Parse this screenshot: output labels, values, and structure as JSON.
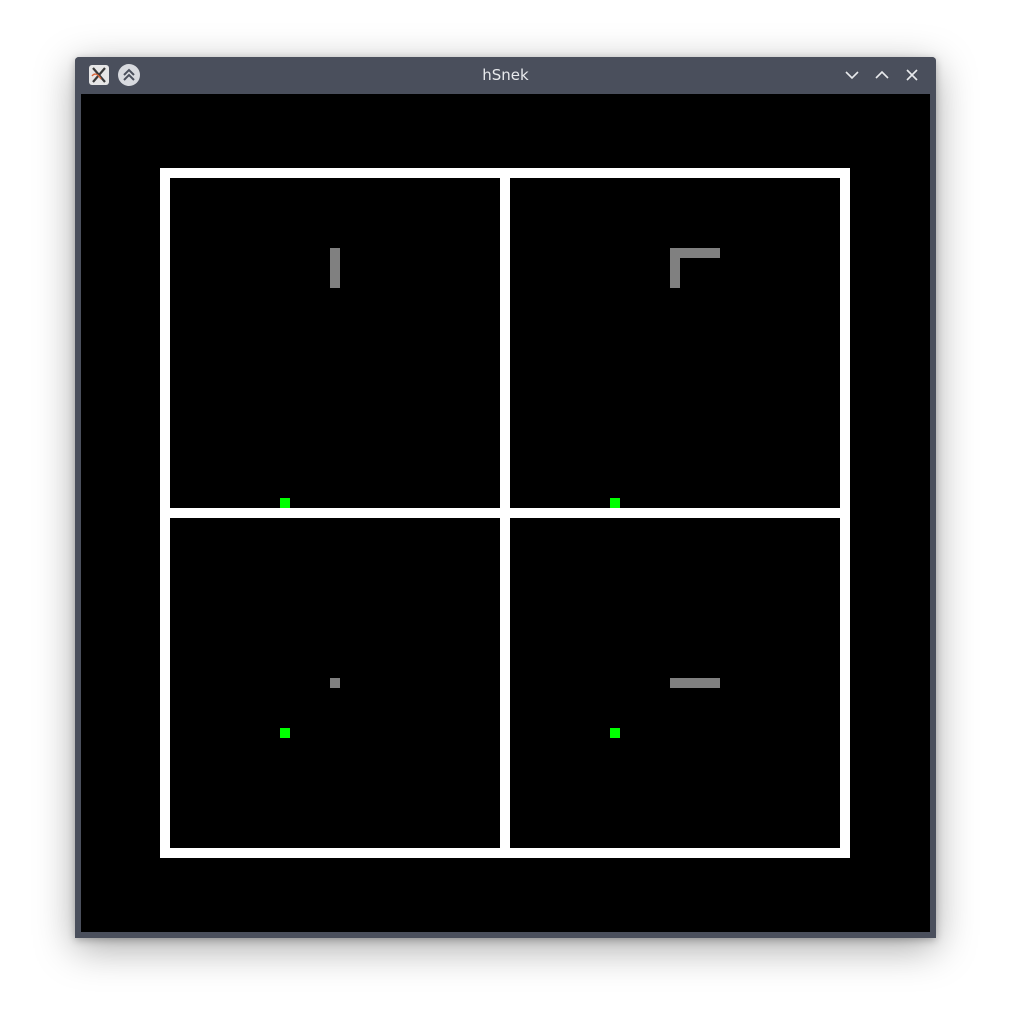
{
  "window": {
    "title": "hSnek",
    "app_icon": "x-app-icon",
    "keep_above_icon": "double-chevron-up-icon",
    "controls": [
      "minimize-chevron-down-icon",
      "maximize-chevron-up-icon",
      "close-x-icon"
    ]
  },
  "game": {
    "board_color": "#000000",
    "border_color": "#ffffff",
    "piece_color": "#808080",
    "food_color": "#00ff00",
    "grid_cells_per_panel": 33,
    "panels": [
      {
        "piece_cells": [
          [
            16,
            7
          ],
          [
            16,
            8
          ],
          [
            16,
            9
          ],
          [
            16,
            10
          ]
        ],
        "food_cell": [
          11,
          32
        ]
      },
      {
        "piece_cells": [
          [
            16,
            7
          ],
          [
            17,
            7
          ],
          [
            18,
            7
          ],
          [
            19,
            7
          ],
          [
            20,
            7
          ],
          [
            16,
            8
          ],
          [
            16,
            9
          ],
          [
            16,
            10
          ]
        ],
        "food_cell": [
          10,
          32
        ]
      },
      {
        "piece_cells": [
          [
            16,
            16
          ]
        ],
        "food_cell": [
          11,
          21
        ]
      },
      {
        "piece_cells": [
          [
            16,
            16
          ],
          [
            17,
            16
          ],
          [
            18,
            16
          ],
          [
            19,
            16
          ],
          [
            20,
            16
          ]
        ],
        "food_cell": [
          10,
          21
        ]
      }
    ]
  }
}
